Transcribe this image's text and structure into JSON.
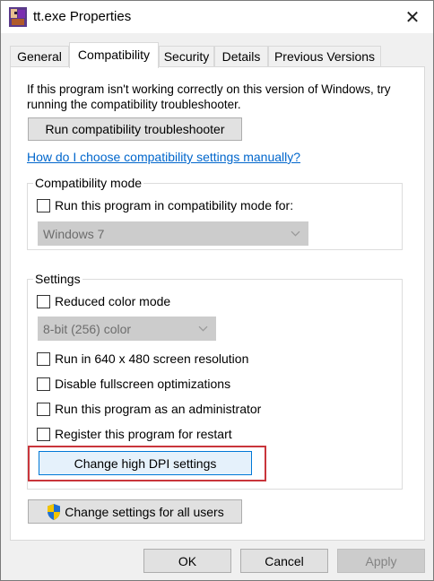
{
  "window": {
    "title": "tt.exe Properties",
    "close_label": "✕"
  },
  "tabs": [
    {
      "label": "General",
      "active": false
    },
    {
      "label": "Compatibility",
      "active": true
    },
    {
      "label": "Security",
      "active": false
    },
    {
      "label": "Details",
      "active": false
    },
    {
      "label": "Previous Versions",
      "active": false
    }
  ],
  "compat": {
    "intro": "If this program isn't working correctly on this version of Windows, try running the compatibility troubleshooter.",
    "troubleshooter_button": "Run compatibility troubleshooter",
    "manual_link": "How do I choose compatibility settings manually?",
    "mode_group": {
      "label": "Compatibility mode",
      "checkbox_label": "Run this program in compatibility mode for:",
      "checked": false,
      "os_select_value": "Windows 7"
    },
    "settings_group": {
      "label": "Settings",
      "reduced_color": {
        "label": "Reduced color mode",
        "checked": false
      },
      "color_select_value": "8-bit (256) color",
      "res_640": {
        "label": "Run in 640 x 480 screen resolution",
        "checked": false
      },
      "disable_fullscreen": {
        "label": "Disable fullscreen optimizations",
        "checked": false
      },
      "run_as_admin": {
        "label": "Run this program as an administrator",
        "checked": false
      },
      "register_restart": {
        "label": "Register this program for restart",
        "checked": false
      },
      "dpi_button": "Change high DPI settings"
    },
    "all_users_button": "Change settings for all users"
  },
  "footer": {
    "ok": "OK",
    "cancel": "Cancel",
    "apply": "Apply"
  },
  "colors": {
    "highlight": "#c9353b",
    "link": "#0066cc",
    "accent": "#0078d7"
  }
}
